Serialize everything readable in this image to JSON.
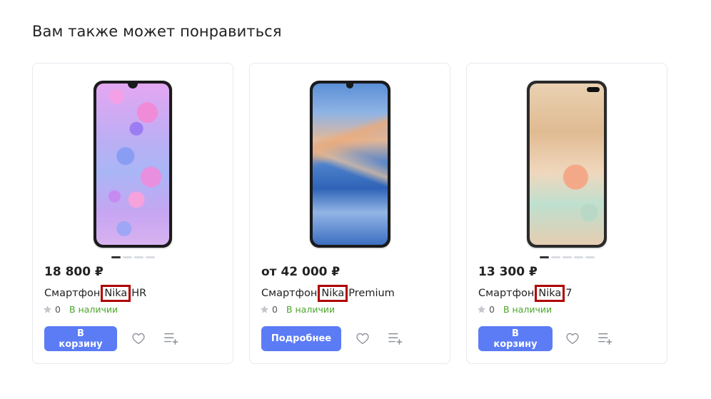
{
  "section": {
    "title": "Вам также может понравиться"
  },
  "products": [
    {
      "price": "18 800 ₽",
      "name_prefix": "Смартфон",
      "name_highlight": "Nika",
      "name_suffix": "HR",
      "rating": "0",
      "stock": "В наличии",
      "button": "В корзину",
      "images": 4,
      "active_image": 0
    },
    {
      "price": "от 42 000 ₽",
      "name_prefix": "Смартфон",
      "name_highlight": "Nika",
      "name_suffix": "Premium",
      "rating": "0",
      "stock": "В наличии",
      "button": "Подробнее",
      "images": 0,
      "active_image": 0
    },
    {
      "price": "13 300 ₽",
      "name_prefix": "Смартфон",
      "name_highlight": "Nika",
      "name_suffix": "7",
      "rating": "0",
      "stock": "В наличии",
      "button": "В корзину",
      "images": 5,
      "active_image": 0
    }
  ],
  "icons": {
    "rating": "star-icon",
    "favorite": "heart-icon",
    "compare": "compare-list-icon"
  },
  "colors": {
    "accent": "#5b7cf5",
    "in_stock": "#4aa62a",
    "highlight_box": "#b00000"
  }
}
